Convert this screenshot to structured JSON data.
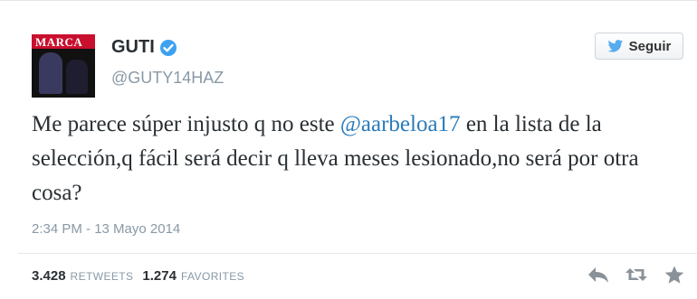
{
  "user": {
    "name": "GUTI",
    "handle": "@GUTY14HAZ",
    "avatar_text": "MARCA"
  },
  "follow_button": {
    "label": "Seguir"
  },
  "tweet": {
    "text_before": "Me parece súper injusto q no este ",
    "mention": "@aarbeloa17",
    "text_after": " en la lista de la selección,q fácil será decir q lleva meses lesionado,no será por otra cosa?",
    "timestamp": "2:34 PM - 13 Mayo 2014"
  },
  "stats": {
    "retweets_count": "3.428",
    "retweets_label": "RETWEETS",
    "favorites_count": "1.274",
    "favorites_label": "FAVORITES"
  },
  "actions": [
    "reply-icon",
    "retweet-icon",
    "favorite-icon"
  ],
  "colors": {
    "accent": "#2b7bb9",
    "verified": "#3ca1f0",
    "muted": "#8899a6",
    "twitter_blue": "#55acee"
  }
}
